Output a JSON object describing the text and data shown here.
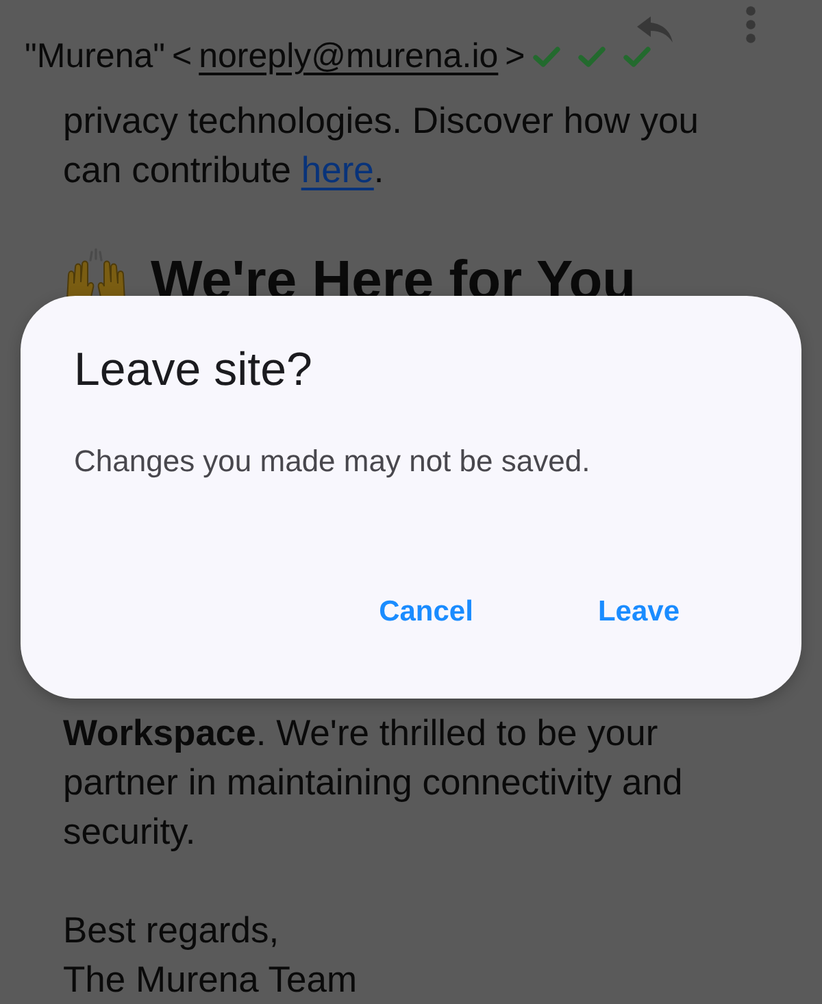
{
  "email": {
    "sender_name": "\"Murena\"",
    "address_open": "<",
    "address": "noreply@murena.io",
    "address_close": ">"
  },
  "body": {
    "paragraph_1": {
      "text": "privacy technologies. Discover how you can contribute ",
      "link": "here",
      "after_link": "."
    },
    "heading": "We're Here for You",
    "paragraph_2": "**Workspace**. We're thrilled to be your partner in maintaining connectivity and security.",
    "closing": [
      "Best regards,",
      "The Murena Team"
    ]
  },
  "dialog": {
    "title": "Leave site?",
    "message": "Changes you made may not be saved.",
    "buttons": [
      "Cancel",
      "Leave"
    ]
  }
}
